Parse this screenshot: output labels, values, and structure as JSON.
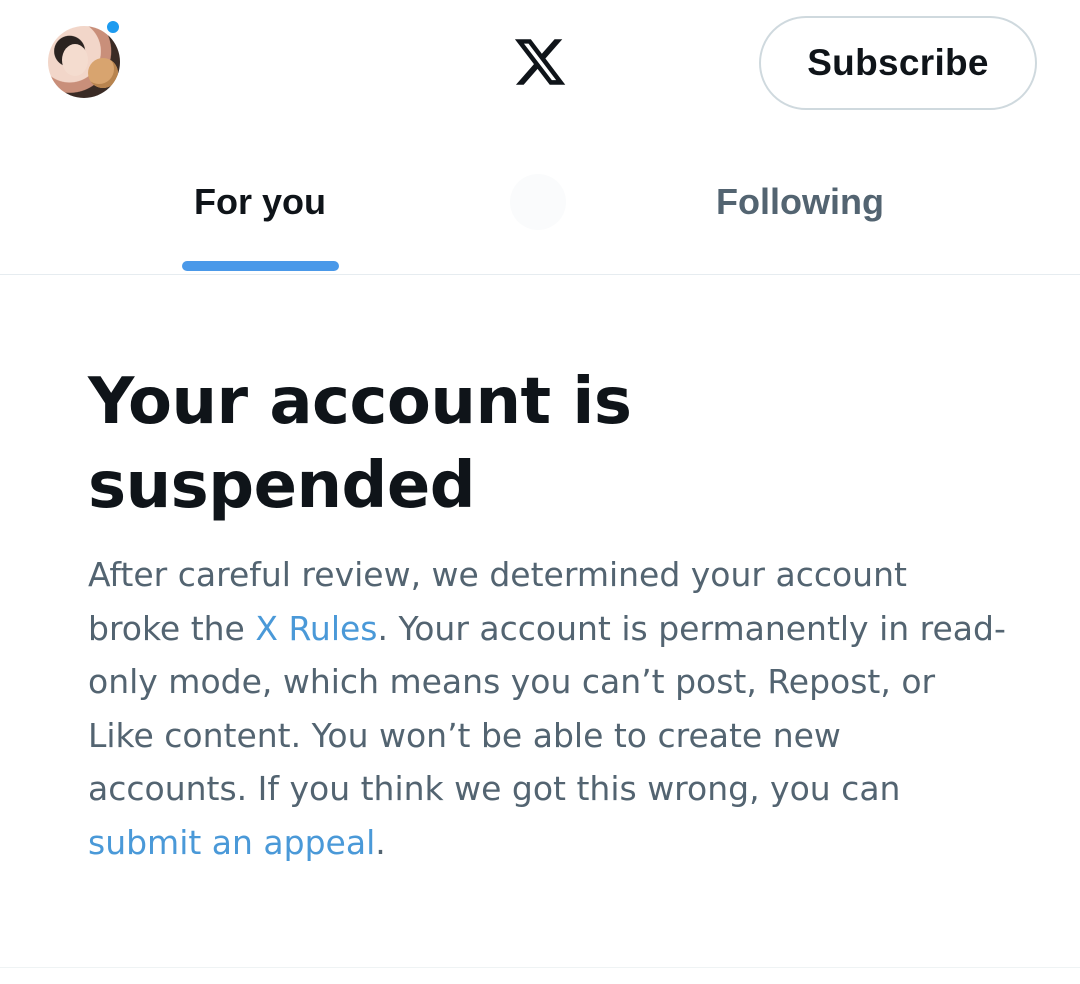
{
  "header": {
    "avatar_icon": "user-avatar",
    "notification_dot_color": "#1d9bf0",
    "logo_icon": "x-logo-icon",
    "subscribe_label": "Subscribe"
  },
  "tabs": [
    {
      "label": "For you",
      "active": true
    },
    {
      "label": "Following",
      "active": false
    }
  ],
  "accent_color": "#4a99e9",
  "notice": {
    "title": "Your account is suspended",
    "text_1": "After careful review, we determined your account broke the ",
    "link_rules": "X Rules",
    "text_2": ". Your account is permanently in read-only mode, which means you can’t post, Repost, or Like content. You won’t be able to create new accounts. If you think we got this wrong, you can ",
    "link_appeal": "submit an appeal",
    "text_3": "."
  }
}
